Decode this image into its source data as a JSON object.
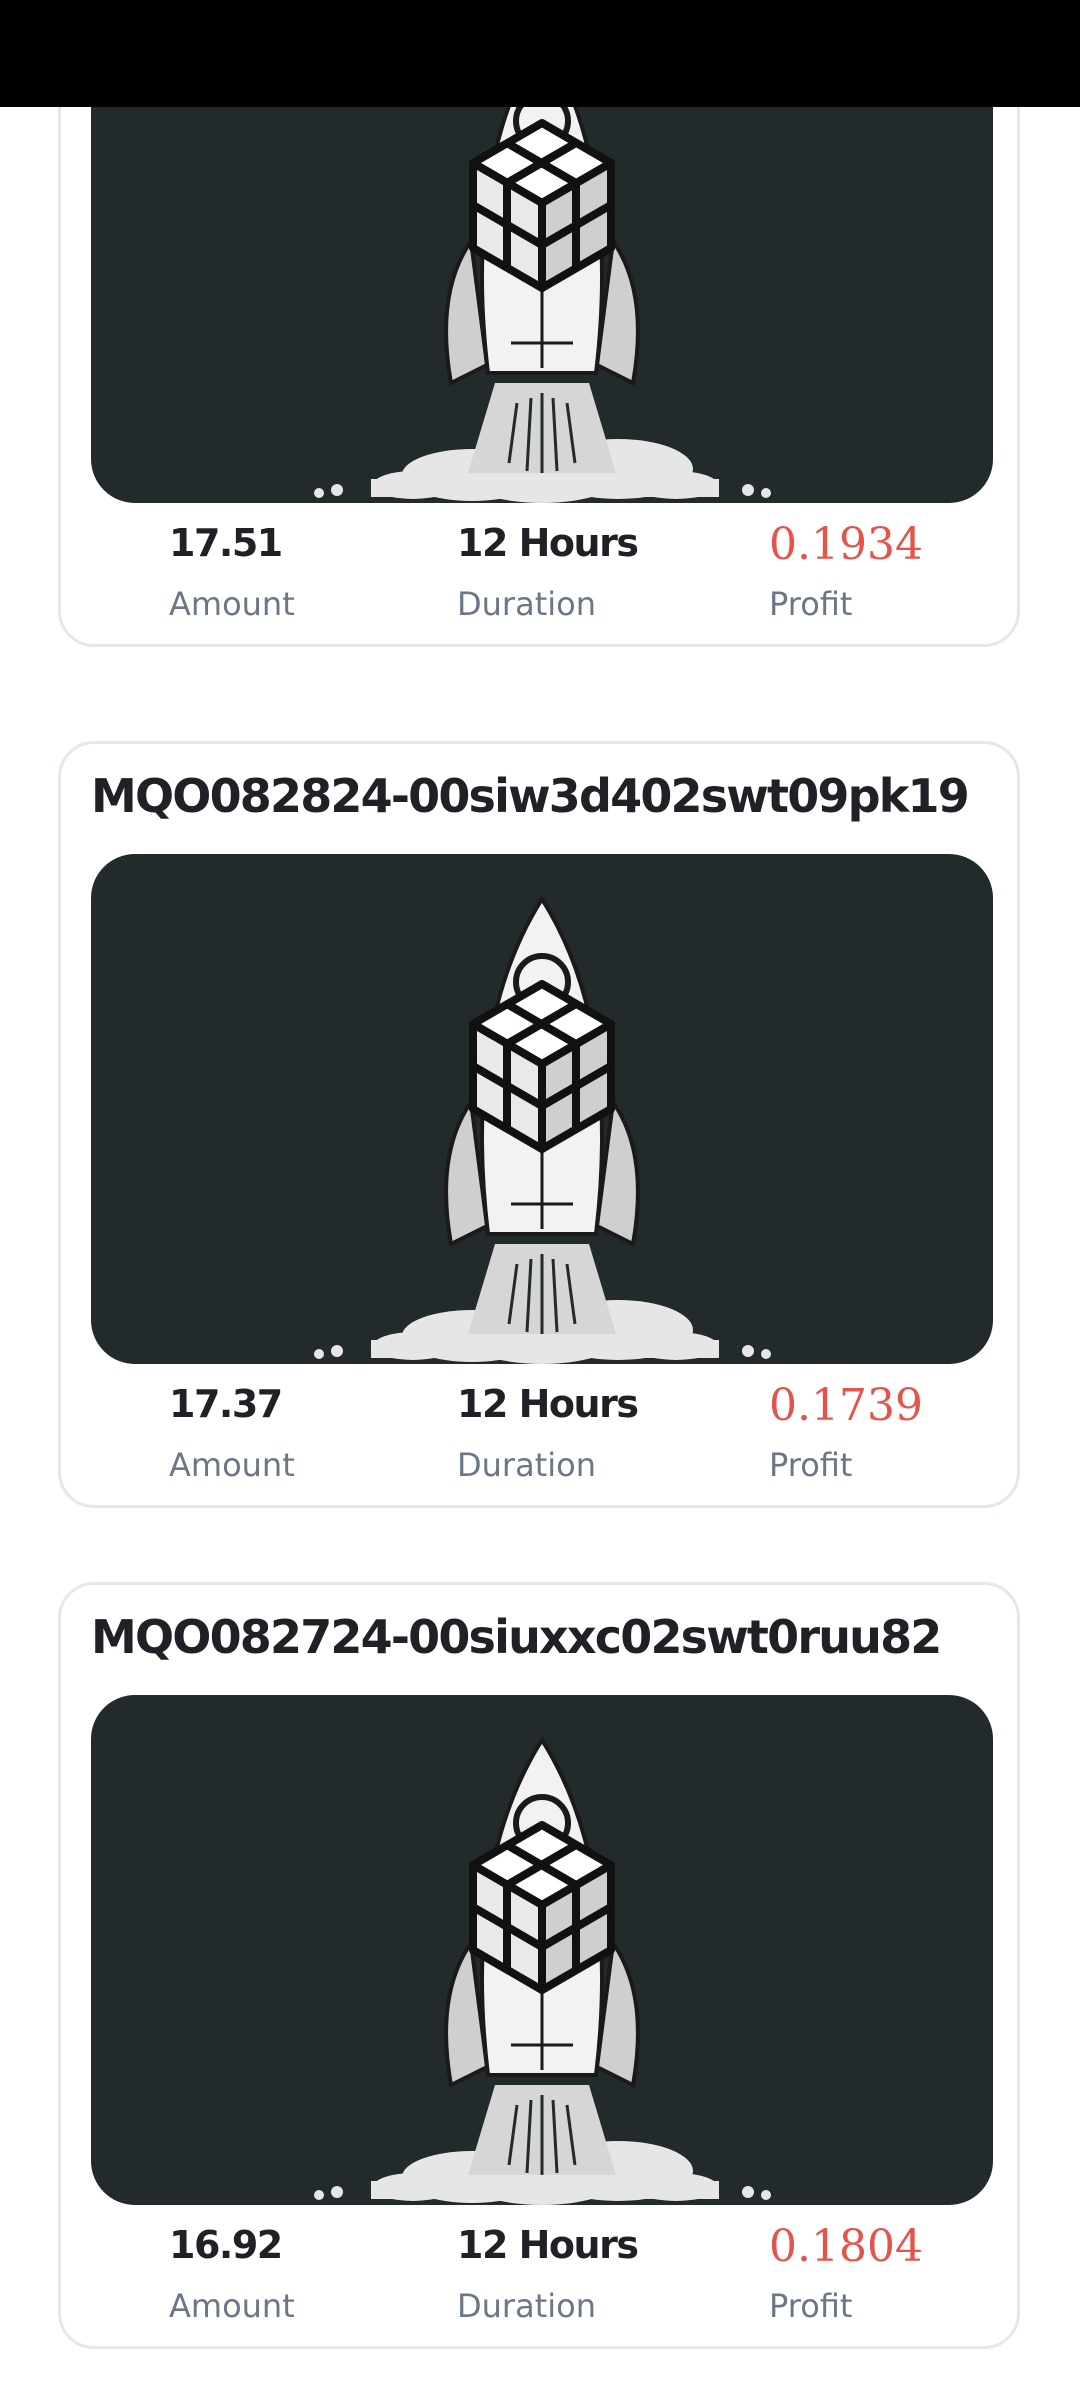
{
  "orders": [
    {
      "id": "",
      "amount": "17.51",
      "duration": "12 Hours",
      "profit": "0.1934"
    },
    {
      "id": "MQO082824-00siw3d402swt09pk19",
      "amount": "17.37",
      "duration": "12 Hours",
      "profit": "0.1739"
    },
    {
      "id": "MQO082724-00siuxxc02swt0ruu82",
      "amount": "16.92",
      "duration": "12 Hours",
      "profit": "0.1804"
    }
  ],
  "labels": {
    "amount": "Amount",
    "duration": "Duration",
    "profit": "Profit"
  },
  "colors": {
    "profit": "#e5534b",
    "thumbnail_bg": "#232a2c",
    "card_border": "#e5e7eb"
  },
  "icons": {
    "thumbnail": "rocket-with-cube-icon"
  }
}
